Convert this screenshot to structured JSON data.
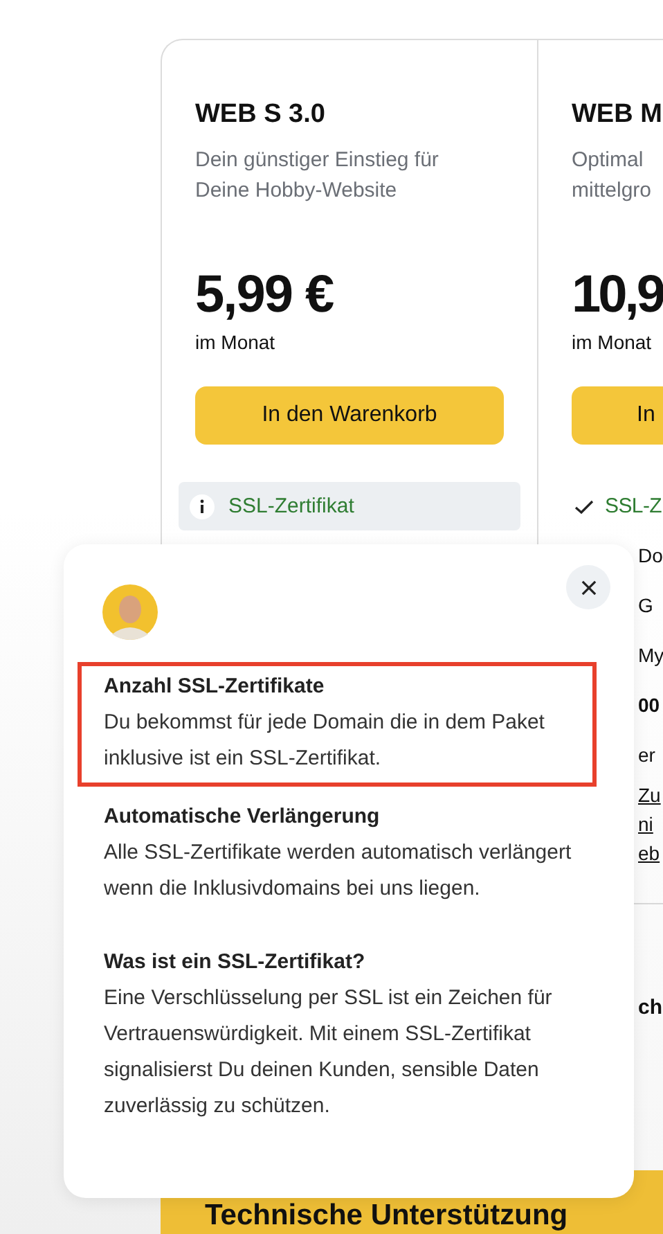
{
  "plans": [
    {
      "title": "WEB S 3.0",
      "description_lines": [
        "Dein günstiger Einstieg für",
        "Deine Hobby-Website"
      ],
      "price": "5,99 €",
      "period": "im Monat",
      "cart_button": "In den Warenkorb",
      "features": [
        {
          "kind": "info",
          "text": "SSL-Zertifikat",
          "selected": true
        }
      ]
    },
    {
      "title": "WEB M",
      "description_lines": [
        "Optimal",
        "mittelgro"
      ],
      "price": "10,9",
      "period": "im Monat",
      "cart_button": "In",
      "features": [
        {
          "kind": "check",
          "text": "SSL-Z",
          "selected": false
        },
        {
          "kind": "text",
          "text": "Do"
        },
        {
          "kind": "text",
          "text": "G"
        },
        {
          "kind": "text",
          "text": "My"
        },
        {
          "kind": "bold",
          "text": "00"
        },
        {
          "kind": "text",
          "text": "er"
        },
        {
          "kind": "link",
          "text": "Zu"
        },
        {
          "kind": "link",
          "text": "ni"
        },
        {
          "kind": "link",
          "text": "eb"
        },
        {
          "kind": "divider"
        },
        {
          "kind": "heading",
          "text": "ch"
        }
      ]
    }
  ],
  "popover": {
    "sections": [
      {
        "heading": "Anzahl SSL-Zertifikate",
        "body": "Du bekommst für jede Domain die in dem Paket inklusive ist ein SSL-Zertifikat.",
        "highlighted": true
      },
      {
        "heading": "Automatische Verlängerung",
        "body": "Alle SSL-Zertifikate werden automatisch verlängert wenn die Inklusivdomains bei uns liegen.",
        "highlighted": false
      },
      {
        "heading": "Was ist ein SSL-Zertifikat?",
        "body": "Eine Verschlüsselung per SSL ist ein Zeichen für Vertrauenswürdigkeit. Mit einem SSL-Zertifikat signalisierst Du deinen Kunden, sensible Daten zuverlässig zu schützen.",
        "highlighted": false
      }
    ]
  },
  "banner": {
    "title": "Technische Unterstützung"
  }
}
